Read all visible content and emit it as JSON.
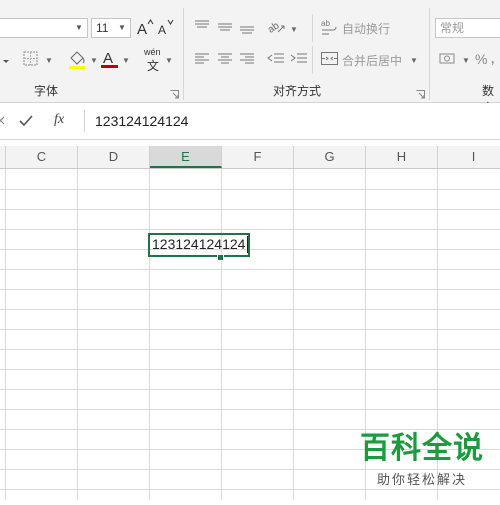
{
  "ribbon": {
    "font_size": "11",
    "number_format": "常规",
    "wrap_text_label": "自动换行",
    "merge_center_label": "合并后居中",
    "groups": {
      "font": "字体",
      "alignment": "对齐方式",
      "number": "数字"
    },
    "phonetic_top": "wén",
    "phonetic_bottom": "文",
    "accent_colors": {
      "font_color": "#c00000",
      "fill_color": "#ffff00",
      "excel_green": "#217346"
    },
    "icons": [
      "font-size-dropdown-arrow",
      "grow-font-icon",
      "shrink-font-icon",
      "border-icon",
      "fill-color-icon",
      "font-color-icon",
      "phonetic-guide-icon",
      "align-top-icon",
      "align-middle-icon",
      "align-bottom-icon",
      "orientation-icon",
      "wrap-text-icon",
      "align-left-icon",
      "align-center-icon",
      "align-right-icon",
      "decrease-indent-icon",
      "increase-indent-icon",
      "merge-center-icon",
      "accounting-format-icon",
      "percent-icon",
      "comma-style-icon"
    ]
  },
  "formula_bar": {
    "cancel_icon": "x",
    "enter_icon": "✓",
    "fx_label": "fx",
    "value": "123124124124"
  },
  "sheet": {
    "columns": [
      "C",
      "D",
      "E",
      "F",
      "G",
      "H",
      "I"
    ],
    "selected_column": "E",
    "active_cell_value": "123124124124"
  },
  "watermark": {
    "main": "百科全说",
    "sub": "助你轻松解决"
  }
}
